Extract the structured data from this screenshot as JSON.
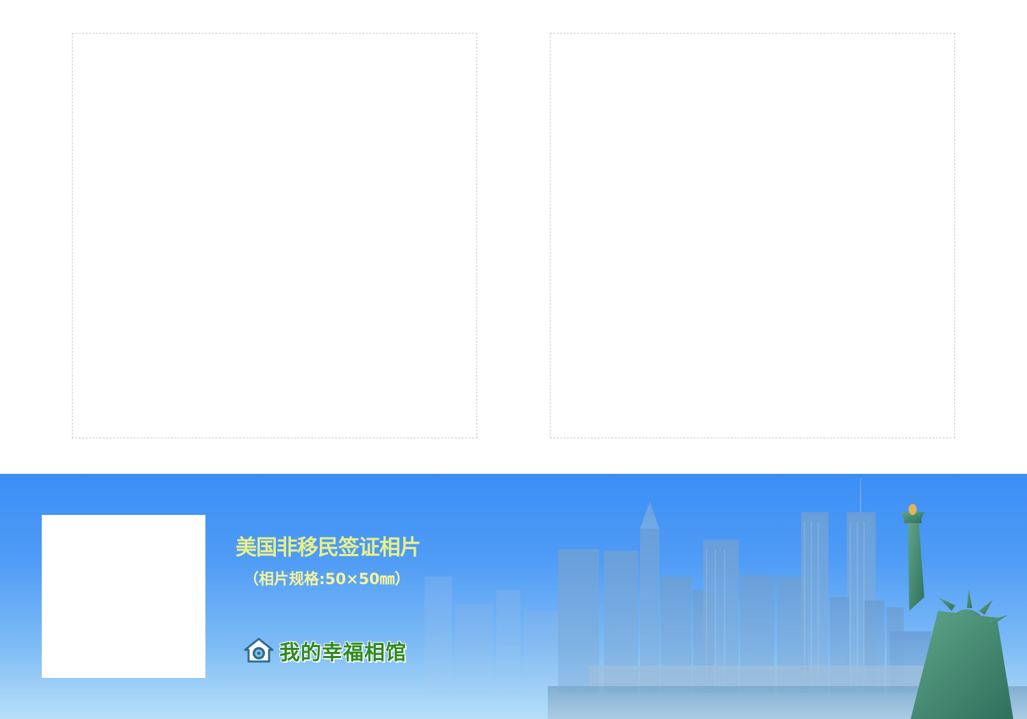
{
  "banner": {
    "title": "美国非移民签证相片",
    "spec": "（相片规格:50×50㎜）",
    "brand_name": "我的幸福相馆",
    "brand_icon": "house-camera-icon",
    "skyline_image": "new-york-skyline-statue-of-liberty"
  },
  "colors": {
    "banner_top": "#3b8ef7",
    "banner_bottom": "#b7dff8",
    "title": "#e9f08a",
    "brand": "#2e8a1f",
    "slot_border": "#c9c9c9"
  }
}
